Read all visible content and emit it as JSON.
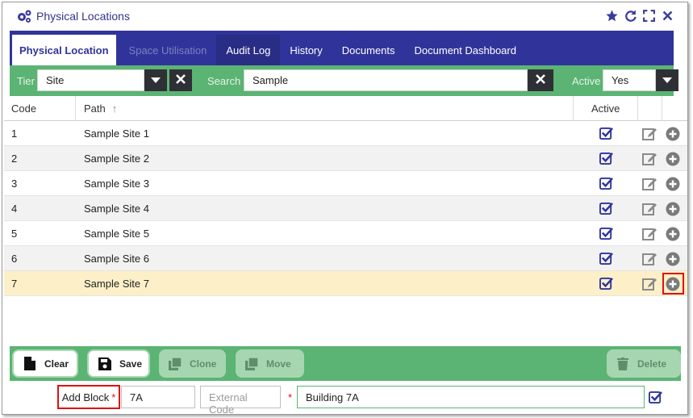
{
  "window": {
    "title": "Physical Locations",
    "title_icon": "cogs-icon",
    "controls": [
      "star-icon",
      "refresh-icon",
      "expand-icon",
      "close-icon"
    ]
  },
  "tabs": [
    {
      "label": "Physical Location",
      "state": "active"
    },
    {
      "label": "Space Utilisation",
      "state": "disabled"
    },
    {
      "label": "Audit Log",
      "state": "normal"
    },
    {
      "label": "History",
      "state": "normal"
    },
    {
      "label": "Documents",
      "state": "normal"
    },
    {
      "label": "Document Dashboard",
      "state": "normal"
    }
  ],
  "filters": {
    "tier_label": "Tier",
    "tier_value": "Site",
    "search_label": "Search",
    "search_value": "Sample",
    "active_label": "Active",
    "active_value": "Yes"
  },
  "table": {
    "headers": {
      "code": "Code",
      "path": "Path",
      "active": "Active"
    },
    "sort_indicator": "↑",
    "rows": [
      {
        "code": "1",
        "path": "Sample Site 1",
        "active": true
      },
      {
        "code": "2",
        "path": "Sample Site 2",
        "active": true
      },
      {
        "code": "3",
        "path": "Sample Site 3",
        "active": true
      },
      {
        "code": "4",
        "path": "Sample Site 4",
        "active": true
      },
      {
        "code": "5",
        "path": "Sample Site 5",
        "active": true
      },
      {
        "code": "6",
        "path": "Sample Site 6",
        "active": true
      },
      {
        "code": "7",
        "path": "Sample Site 7",
        "active": true,
        "selected": true
      }
    ]
  },
  "actions": {
    "clear": "Clear",
    "save": "Save",
    "clone": "Clone",
    "move": "Move",
    "delete": "Delete"
  },
  "form": {
    "label": "Add Block",
    "required_mark": "*",
    "code_value": "7A",
    "external_code_placeholder": "External Code",
    "name_value": "Building 7A",
    "active_checked": true
  },
  "colors": {
    "primary": "#30349a",
    "green": "#5bb473",
    "selected_row": "#fdf0c8",
    "highlight": "#e01010"
  }
}
